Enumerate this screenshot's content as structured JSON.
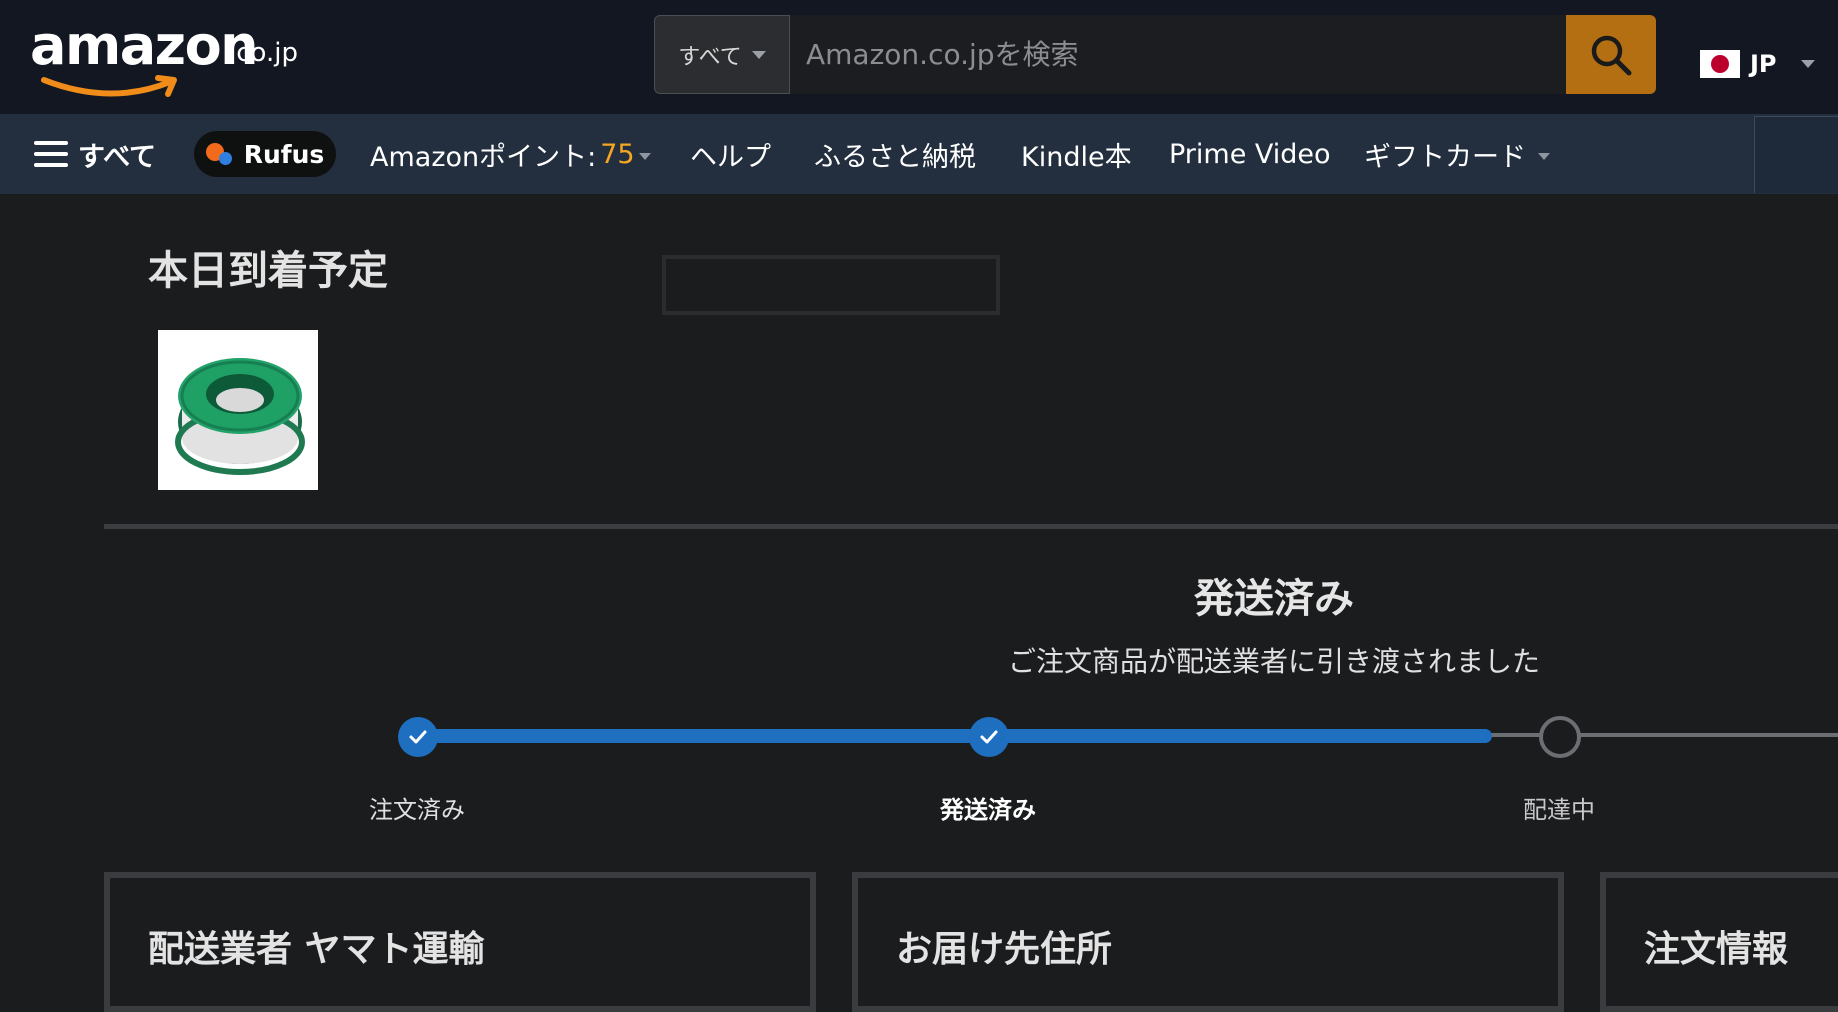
{
  "header": {
    "logo_text": "amazon",
    "logo_suffix": ".co.jp",
    "search": {
      "category": "すべて",
      "placeholder": "Amazon.co.jpを検索"
    },
    "locale": {
      "label": "JP"
    }
  },
  "nav": {
    "menu_label": "すべて",
    "rufus_label": "Rufus",
    "points_label": "Amazonポイント:",
    "points_value": "75",
    "items": [
      "ヘルプ",
      "ふるさと納税",
      "Kindle本",
      "Prime Video",
      "ギフトカード"
    ]
  },
  "delivery": {
    "title": "本日到着予定"
  },
  "status": {
    "heading": "発送済み",
    "subtext": "ご注文商品が配送業者に引き渡されました",
    "progress_steps_completed": 2,
    "steps": [
      {
        "label": "注文済み",
        "state": "done"
      },
      {
        "label": "発送済み",
        "state": "current"
      },
      {
        "label": "配達中",
        "state": "pending"
      }
    ]
  },
  "cards": [
    {
      "title": "配送業者 ヤマト運輸"
    },
    {
      "title": "お届け先住所"
    },
    {
      "title": "注文情報"
    }
  ],
  "colors": {
    "header_bg": "#121722",
    "nav_bg": "#232f3e",
    "search_button": "#b36f12",
    "accent_points": "#f5a623",
    "progress": "#1f6fc1",
    "page_bg": "#1b1c1e"
  }
}
